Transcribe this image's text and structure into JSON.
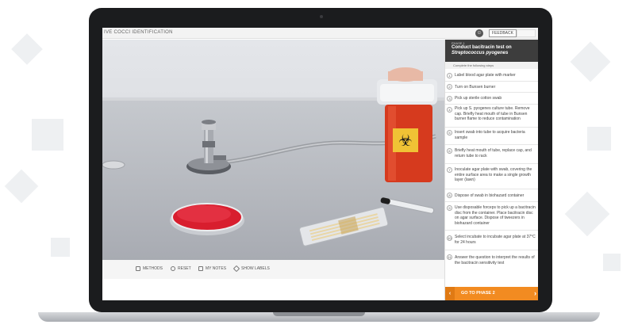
{
  "app": {
    "title": "IVE COCCI IDENTIFICATION",
    "feedback_label": "FEEDBACK"
  },
  "icons": {
    "accessibility": "accessibility-icon",
    "methods": "methods-icon",
    "reset": "reset-icon",
    "notes": "notes-icon",
    "labels": "labels-icon",
    "biohazard": "biohazard-icon"
  },
  "toolbar": {
    "methods": "METHODS",
    "reset": "RESET",
    "notes": "MY NOTES",
    "labels": "SHOW LABELS"
  },
  "panel": {
    "phase": "PHASE 1",
    "title": "Conduct bacitracin test on",
    "title_italic": "Streptococcus pyogenes",
    "instruction": "Complete the following steps",
    "steps": [
      {
        "n": "1",
        "text": "Label blood agar plate with marker"
      },
      {
        "n": "2",
        "text": "Turn on Bunsen burner"
      },
      {
        "n": "3",
        "text": "Pick up sterile cotton swab"
      },
      {
        "n": "4",
        "text": "Pick up S. pyogenes culture tube. Remove cap. Briefly heat mouth of tube in Bunsen burner flame to reduce contamination"
      },
      {
        "n": "5",
        "text": "Insert swab into tube to acquire bacteria sample"
      },
      {
        "n": "6",
        "text": "Briefly heat mouth of tube, replace cap, and return tube to rack"
      },
      {
        "n": "7",
        "text": "Inoculate agar plate with swab, covering the entire surface area to make a single growth layer (lawn)"
      },
      {
        "n": "8",
        "text": "Dispose of swab in biohazard container"
      },
      {
        "n": "9",
        "text": "Use disposable forceps to pick up a bacitracin disc from the container. Place bacitracin disc on agar surface. Dispose of tweezers in biohazard container"
      },
      {
        "n": "10",
        "text": "Select incubate to incubate agar plate at 37°C for 24 hours"
      },
      {
        "n": "11",
        "text": "Answer the question to interpret the results of the bacitracin sensitivity test"
      }
    ],
    "go_label": "GO TO PHASE 2"
  },
  "colors": {
    "accent": "#f28b21",
    "panel_header": "#3d3d3d",
    "biohazard_red": "#d63a1e",
    "agar": "#d81e2e"
  }
}
